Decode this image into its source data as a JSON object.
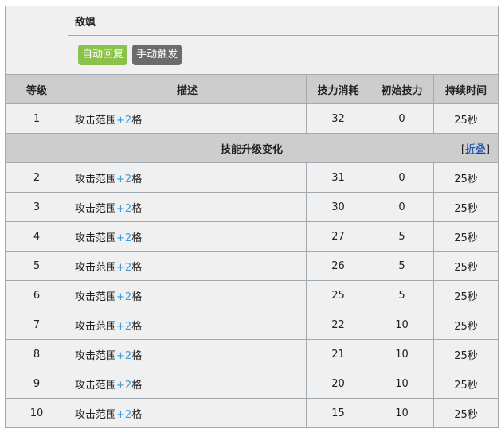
{
  "skill": {
    "name": "敌飒",
    "tags": [
      "自动回复",
      "手动触发"
    ]
  },
  "headers": {
    "level": "等级",
    "description": "描述",
    "sp_cost": "技力消耗",
    "initial_sp": "初始技力",
    "duration": "持续时间"
  },
  "upgrade_label": "技能升级变化",
  "collapse": {
    "open": "[",
    "link": "折叠",
    "close": "]"
  },
  "rows": [
    {
      "level": "1",
      "desc_text": "攻击范围",
      "desc_value": "+2",
      "desc_suffix": "格",
      "sp_cost": "32",
      "initial_sp": "0",
      "duration": "25秒"
    },
    {
      "level": "2",
      "desc_text": "攻击范围",
      "desc_value": "+2",
      "desc_suffix": "格",
      "sp_cost": "31",
      "initial_sp": "0",
      "duration": "25秒"
    },
    {
      "level": "3",
      "desc_text": "攻击范围",
      "desc_value": "+2",
      "desc_suffix": "格",
      "sp_cost": "30",
      "initial_sp": "0",
      "duration": "25秒"
    },
    {
      "level": "4",
      "desc_text": "攻击范围",
      "desc_value": "+2",
      "desc_suffix": "格",
      "sp_cost": "27",
      "initial_sp": "5",
      "duration": "25秒"
    },
    {
      "level": "5",
      "desc_text": "攻击范围",
      "desc_value": "+2",
      "desc_suffix": "格",
      "sp_cost": "26",
      "initial_sp": "5",
      "duration": "25秒"
    },
    {
      "level": "6",
      "desc_text": "攻击范围",
      "desc_value": "+2",
      "desc_suffix": "格",
      "sp_cost": "25",
      "initial_sp": "5",
      "duration": "25秒"
    },
    {
      "level": "7",
      "desc_text": "攻击范围",
      "desc_value": "+2",
      "desc_suffix": "格",
      "sp_cost": "22",
      "initial_sp": "10",
      "duration": "25秒"
    },
    {
      "level": "8",
      "desc_text": "攻击范围",
      "desc_value": "+2",
      "desc_suffix": "格",
      "sp_cost": "21",
      "initial_sp": "10",
      "duration": "25秒"
    },
    {
      "level": "9",
      "desc_text": "攻击范围",
      "desc_value": "+2",
      "desc_suffix": "格",
      "sp_cost": "20",
      "initial_sp": "10",
      "duration": "25秒"
    },
    {
      "level": "10",
      "desc_text": "攻击范围",
      "desc_value": "+2",
      "desc_suffix": "格",
      "sp_cost": "15",
      "initial_sp": "10",
      "duration": "25秒"
    }
  ]
}
